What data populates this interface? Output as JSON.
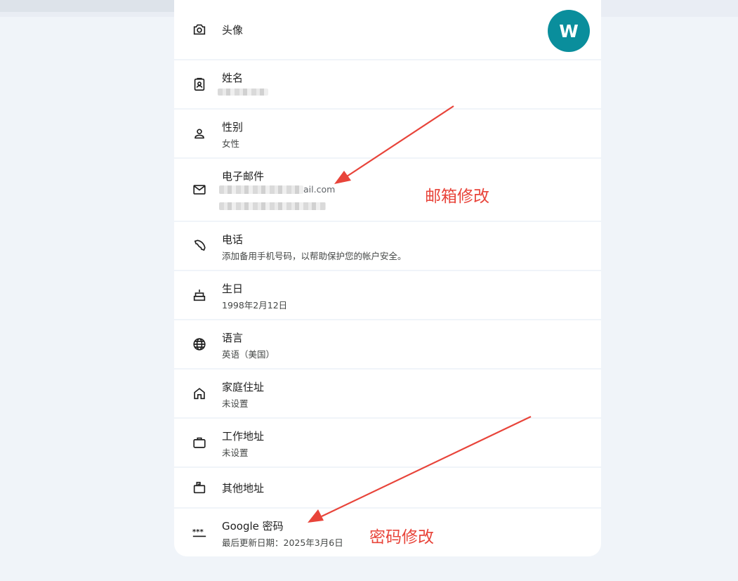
{
  "rows": {
    "photo": {
      "title": "头像",
      "icon": "camera-icon",
      "avatar_letter": "W"
    },
    "name": {
      "title": "姓名",
      "icon": "contact-badge-icon",
      "value_redacted": true
    },
    "gender": {
      "title": "性别",
      "value": "女性",
      "icon": "person-icon"
    },
    "email": {
      "title": "电子邮件",
      "value_suffix": "ail.com",
      "icon": "mail-icon",
      "value_redacted": true
    },
    "phone": {
      "title": "电话",
      "value": "添加备用手机号码，以帮助保护您的帐户安全。",
      "icon": "phone-icon"
    },
    "birthday": {
      "title": "生日",
      "value": "1998年2月12日",
      "icon": "cake-icon"
    },
    "language": {
      "title": "语言",
      "value": "英语（美国）",
      "icon": "globe-icon"
    },
    "home": {
      "title": "家庭住址",
      "value": "未设置",
      "icon": "home-icon"
    },
    "work": {
      "title": "工作地址",
      "value": "未设置",
      "icon": "briefcase-icon"
    },
    "other": {
      "title": "其他地址",
      "icon": "mailbox-icon"
    },
    "password": {
      "title": "Google 密码",
      "value": "最后更新日期：2025年3月6日",
      "icon": "password-icon"
    }
  },
  "annotations": {
    "email_note": "邮箱修改",
    "password_note": "密码修改"
  },
  "colors": {
    "page_bg": "#f0f4f9",
    "avatar_bg": "#0a8e9c",
    "annotation": "#e8443a"
  }
}
